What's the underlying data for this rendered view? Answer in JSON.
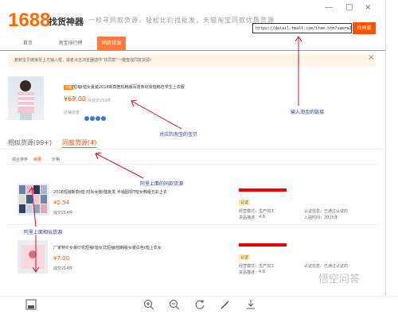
{
  "app": {
    "logo": "1688",
    "title": "找货神器",
    "slogan": "一秒寻同款货源，轻松比价找批发，天猫淘宝同款优质货源",
    "controls": {
      "min": "—",
      "max": "□",
      "close": "×"
    }
  },
  "search": {
    "url": "https://detail.tmall.com/item.htm?spm=a230r.1.14",
    "button": "找同款"
  },
  "tabs": [
    "首页",
    "淘宝排行榜",
    "同款货源"
  ],
  "notice": {
    "text": "复制宝贝链接至上方输入框，或者点击浏览器插件“找同款”一键查找同款货源！",
    "close": "×"
  },
  "product": {
    "tag": "天猫",
    "title": "短袖t恤女夏装2018新款宽松韩版百搭条纹体恤韩范学生上衣服",
    "price": "¥69.00",
    "sales_label": "月成交253件",
    "shop_label": "店铺信誉"
  },
  "subtabs": {
    "similar": "相似货源(99+)",
    "same": "同款货源(4)"
  },
  "filters": [
    "综合排序",
    "销量",
    "价格"
  ],
  "annotations": {
    "input_link": "输入淘宝的链接",
    "taobao_item": "对应的淘宝的宝贝",
    "ali_same": "阿里上面的同款货源",
    "ali_similar": "阿里上面相似货源"
  },
  "rows": [
    {
      "title": "2018短袖新款t恤 时尚女装t恤批发 半袖圆领T恤女韩版五彩上衣",
      "price": "¥2.94",
      "sales": "成交214件",
      "vendor": "生产加工",
      "grade": "4.8",
      "badge": "认证",
      "cert": "已通过认证的",
      "years": "2015年"
    },
    {
      "title": "厂家特价女装印花短袖t恤女式短袖t恤韩版女装白色t恤上衣女",
      "price": "¥7.00",
      "sales": "成交214件",
      "vendor": "生产加工",
      "grade": "4.8",
      "badge": "认证",
      "cert": "已通过认证的",
      "years": ""
    }
  ],
  "row_labels": {
    "vendor_label": "经营模式：",
    "grade_label": "货品描述：",
    "cert_label": "认证信息：",
    "years_label": "入驻时间："
  },
  "watermark": "悟空问答",
  "toolbar": [
    "save-icon",
    "zoom-in-icon",
    "zoom-out-icon",
    "rotate-icon",
    "edit-icon",
    "download-icon"
  ]
}
